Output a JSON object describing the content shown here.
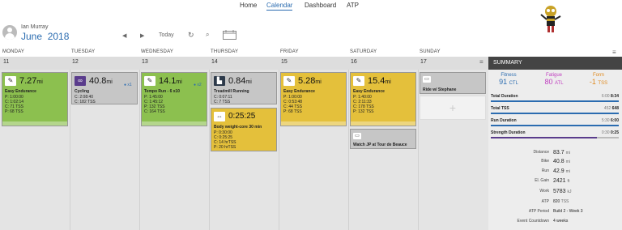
{
  "nav": {
    "items": [
      "Home",
      "Calendar",
      "Dashboard",
      "ATP"
    ],
    "active": "Calendar"
  },
  "user": {
    "name": "Ian Murray",
    "month": "June",
    "year": "2018"
  },
  "toolbar": {
    "today": "Today"
  },
  "days": [
    "MONDAY",
    "TUESDAY",
    "WEDNESDAY",
    "THURSDAY",
    "FRIDAY",
    "SATURDAY",
    "SUNDAY"
  ],
  "dates": [
    "11",
    "12",
    "13",
    "14",
    "15",
    "16",
    "17"
  ],
  "workouts": [
    {
      "value": "7.27",
      "unit": "mi",
      "title": "Easy Endurance",
      "stats": "P: 1:00:00\nC: 1:02:14\nC: 71 TSS\nP: 68 TSS",
      "color": "green",
      "icon": "run-icon"
    },
    {
      "value": "40.8",
      "unit": "mi",
      "title": "Cycling",
      "stats": "C: 2:08:40\nC: 182 TSS",
      "color": "grey",
      "icon": "bike-icon",
      "badge": "x1"
    },
    {
      "value": "14.1",
      "unit": "mi",
      "title": "Tempo Run - 6 x10",
      "stats": "P: 1:45:00\nC: 1:45:12\nP: 132 TSS\nC: 164 TSS",
      "color": "green",
      "icon": "run-icon",
      "badge": "x2"
    },
    {
      "value": "0.84",
      "unit": "mi",
      "title": "Treadmill Running",
      "stats": "C: 0:07:11\nC: 7 TSS",
      "color": "grey",
      "icon": "treadmill-icon"
    },
    {
      "value": "0:25:25",
      "unit": "",
      "title": "Body weight-core 30 min",
      "stats": "P: 0:30:00\nC: 0:25:25\nC: 14 hrTSS\nP: 20 hrTSS",
      "color": "yellow",
      "icon": "strength-icon"
    },
    {
      "value": "5.28",
      "unit": "mi",
      "title": "Easy Endurance",
      "stats": "P: 1:00:00\nC: 0:53:48\nC: 44 TSS\nP: 68 TSS",
      "color": "yellow",
      "icon": "run-icon"
    },
    {
      "value": "15.4",
      "unit": "mi",
      "title": "Easy Endurance",
      "stats": "P: 1:40:00\nC: 2:11:33\nC: 178 TSS\nP: 132 TSS",
      "color": "yellow",
      "icon": "run-icon"
    },
    {
      "value": "",
      "unit": "",
      "title": "Watch JP at Tour de Beauce",
      "stats": "",
      "color": "grey",
      "icon": "event-icon"
    },
    {
      "value": "",
      "unit": "",
      "title": "Ride w/ Stephane",
      "stats": "",
      "color": "grey",
      "icon": "event-icon"
    }
  ],
  "summary": {
    "title": "SUMMARY",
    "fitness": {
      "label": "Fitness",
      "value": "91",
      "unit": "CTL",
      "color": "#2b6cb0"
    },
    "fatigue": {
      "label": "Fatigue",
      "value": "80",
      "unit": "ATL",
      "color": "#c03fc0"
    },
    "form": {
      "label": "Form",
      "value": "-1",
      "unit": "TSS",
      "color": "#e08a1e"
    },
    "rows": [
      {
        "label": "Total Duration",
        "planned": "6:00",
        "completed": "8:34",
        "fraction": 1.0,
        "color": "#2b6cb0"
      },
      {
        "label": "Total TSS",
        "planned": "452",
        "completed": "648",
        "fraction": 1.0,
        "color": "#2b6cb0"
      },
      {
        "label": "Run Duration",
        "planned": "5:30",
        "completed": "6:00",
        "fraction": 1.0,
        "color": "#2b6cb0"
      },
      {
        "label": "Strength Duration",
        "planned": "0:30",
        "completed": "0:25",
        "fraction": 0.83,
        "color": "#5a3c8c"
      }
    ],
    "stats": [
      {
        "label": "Distance",
        "value": "83.7",
        "unit": "mi"
      },
      {
        "label": "Bike",
        "value": "40.8",
        "unit": "mi"
      },
      {
        "label": "Run",
        "value": "42.9",
        "unit": "mi"
      },
      {
        "label": "El. Gain",
        "value": "2421",
        "unit": "ft"
      },
      {
        "label": "Work",
        "value": "5783",
        "unit": "kJ"
      },
      {
        "label": "ATP",
        "value": "820",
        "unit": "TSS"
      },
      {
        "label": "ATP Period",
        "value": "Build 2 - Week 3",
        "unit": ""
      },
      {
        "label": "Event Countdown",
        "value": "4 weeks",
        "unit": ""
      }
    ]
  }
}
